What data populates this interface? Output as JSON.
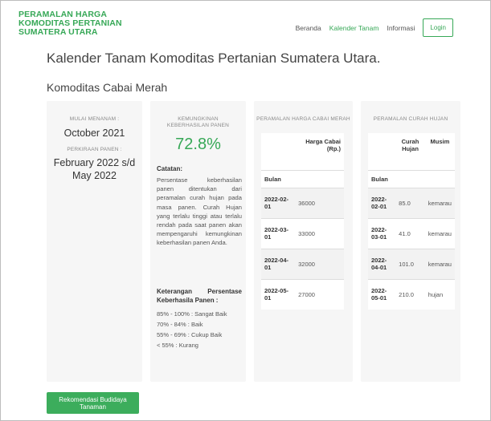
{
  "brand": {
    "line1": "PERAMALAN HARGA",
    "line2": "KOMODITAS PERTANIAN",
    "line3": "SUMATERA UTARA"
  },
  "nav": {
    "home": "Beranda",
    "calendar": "Kalender Tanam",
    "info": "Informasi",
    "login": "Login"
  },
  "page": {
    "title": "Kalender Tanam Komoditas Pertanian Sumatera Utara.",
    "subtitle": "Komoditas Cabai Merah"
  },
  "planting": {
    "start_label": "MULAI MENANAM :",
    "start_value": "October 2021",
    "harvest_label": "PERKIRAAN PANEN :",
    "harvest_value": "February 2022 s/d May 2022"
  },
  "success": {
    "label": "KEMUNGKINAN KEBERHASILAN PANEN",
    "value": "72.8%",
    "note_title": "Catatan:",
    "note_text": "Persentase keberhasilan panen ditentukan dari peramalan curah hujan pada masa panen. Curah Hujan yang terlalu tinggi atau terlalu rendah pada saat panen akan mempengaruhi kemungkinan keberhasilan panen Anda.",
    "legend_title_1": "Keterangan Persentase",
    "legend_title_2": "Keberhasila Panen :",
    "legend": [
      "85% - 100% : Sangat Baik",
      "70% - 84% : Baik",
      "55% - 69% : Cukup Baik",
      "< 55% : Kurang"
    ]
  },
  "price_table": {
    "title": "PERAMALAN HARGA CABAI MERAH",
    "col_price": "Harga Cabai (Rp.)",
    "col_month": "Bulan",
    "rows": [
      {
        "month": "2022-02-01",
        "value": "36000"
      },
      {
        "month": "2022-03-01",
        "value": "33000"
      },
      {
        "month": "2022-04-01",
        "value": "32000"
      },
      {
        "month": "2022-05-01",
        "value": "27000"
      }
    ]
  },
  "rain_table": {
    "title": "PERAMALAN CURAH HUJAN",
    "col_rain": "Curah Hujan",
    "col_season": "Musim",
    "col_month": "Bulan",
    "rows": [
      {
        "month": "2022-02-01",
        "rain": "85.0",
        "season": "kemarau"
      },
      {
        "month": "2022-03-01",
        "rain": "41.0",
        "season": "kemarau"
      },
      {
        "month": "2022-04-01",
        "rain": "101.0",
        "season": "kemarau"
      },
      {
        "month": "2022-05-01",
        "rain": "210.0",
        "season": "hujan"
      }
    ]
  },
  "actions": {
    "recommend": "Rekomendasi Budidaya Tanaman"
  },
  "colors": {
    "accent": "#37a857",
    "card_bg": "#f6f6f6"
  }
}
